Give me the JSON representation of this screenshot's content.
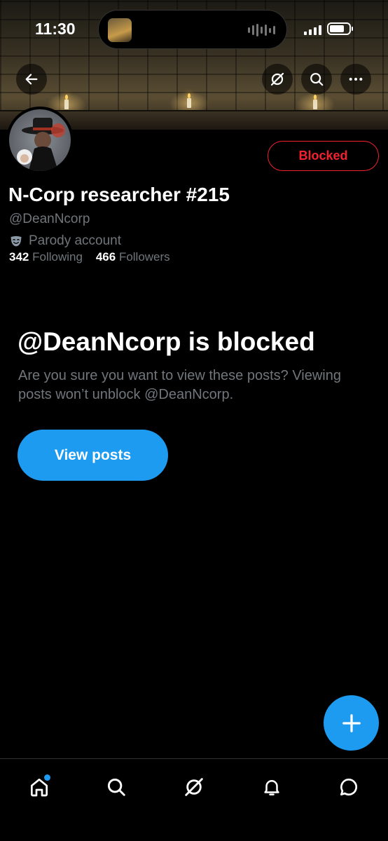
{
  "status_bar": {
    "time": "11:30"
  },
  "profile": {
    "name": "N-Corp researcher #215",
    "handle": "@DeanNcorp",
    "label": "Parody account",
    "following_count": "342",
    "following_label": "Following",
    "followers_count": "466",
    "followers_label": "Followers",
    "blocked_button": "Blocked"
  },
  "blocked_notice": {
    "title": "@DeanNcorp is blocked",
    "description": "Are you sure you want to view these posts? Viewing posts won’t unblock @DeanNcorp.",
    "button": "View posts"
  },
  "icons": {
    "back": "back-arrow-icon",
    "grok": "grok-icon",
    "search": "search-icon",
    "more": "more-icon",
    "parody": "parody-mask-icon",
    "compose": "plus-icon",
    "tabs": [
      "home-icon",
      "search-icon",
      "grok-icon",
      "bell-icon",
      "messages-icon"
    ]
  },
  "colors": {
    "accent": "#1d9bf0",
    "blocked": "#f4212e",
    "muted": "#71767b",
    "background": "#000000"
  }
}
